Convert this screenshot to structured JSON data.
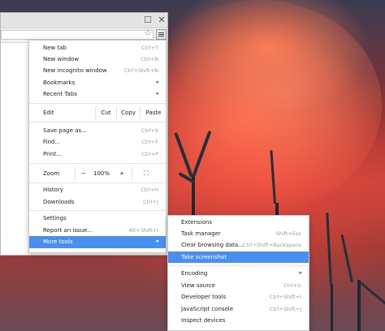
{
  "window": {
    "star_icon": "star-icon",
    "menu_icon": "hamburger-menu-icon"
  },
  "menu": {
    "new_tab": {
      "label": "New tab",
      "shortcut": "Ctrl+T"
    },
    "new_window": {
      "label": "New window",
      "shortcut": "Ctrl+N"
    },
    "new_incognito": {
      "label": "New incognito window",
      "shortcut": "Ctrl+Shift+N"
    },
    "bookmarks": {
      "label": "Bookmarks"
    },
    "recent_tabs": {
      "label": "Recent Tabs"
    },
    "edit": {
      "label": "Edit",
      "cut": "Cut",
      "copy": "Copy",
      "paste": "Paste"
    },
    "save_page": {
      "label": "Save page as...",
      "shortcut": "Ctrl+S"
    },
    "find": {
      "label": "Find...",
      "shortcut": "Ctrl+F"
    },
    "print": {
      "label": "Print...",
      "shortcut": "Ctrl+P"
    },
    "zoom": {
      "label": "Zoom",
      "minus": "−",
      "value": "100%",
      "plus": "+"
    },
    "history": {
      "label": "History",
      "shortcut": "Ctrl+H"
    },
    "downloads": {
      "label": "Downloads",
      "shortcut": "Ctrl+J"
    },
    "settings": {
      "label": "Settings"
    },
    "report_issue": {
      "label": "Report an issue...",
      "shortcut": "Alt+Shift+I"
    },
    "more_tools": {
      "label": "More tools"
    }
  },
  "submenu": {
    "extensions": {
      "label": "Extensions"
    },
    "task_manager": {
      "label": "Task manager",
      "shortcut": "Shift+Esc"
    },
    "clear_data": {
      "label": "Clear browsing data...",
      "shortcut": "Ctrl+Shift+Backspace"
    },
    "take_screenshot": {
      "label": "Take screenshot"
    },
    "encoding": {
      "label": "Encoding"
    },
    "view_source": {
      "label": "View source",
      "shortcut": "Ctrl+U"
    },
    "developer_tools": {
      "label": "Developer tools",
      "shortcut": "Ctrl+Shift+I"
    },
    "javascript_console": {
      "label": "JavaScript console",
      "shortcut": "Ctrl+Shift+J"
    },
    "inspect_devices": {
      "label": "Inspect devices"
    }
  },
  "colors": {
    "highlight": "#4a8ef0"
  }
}
